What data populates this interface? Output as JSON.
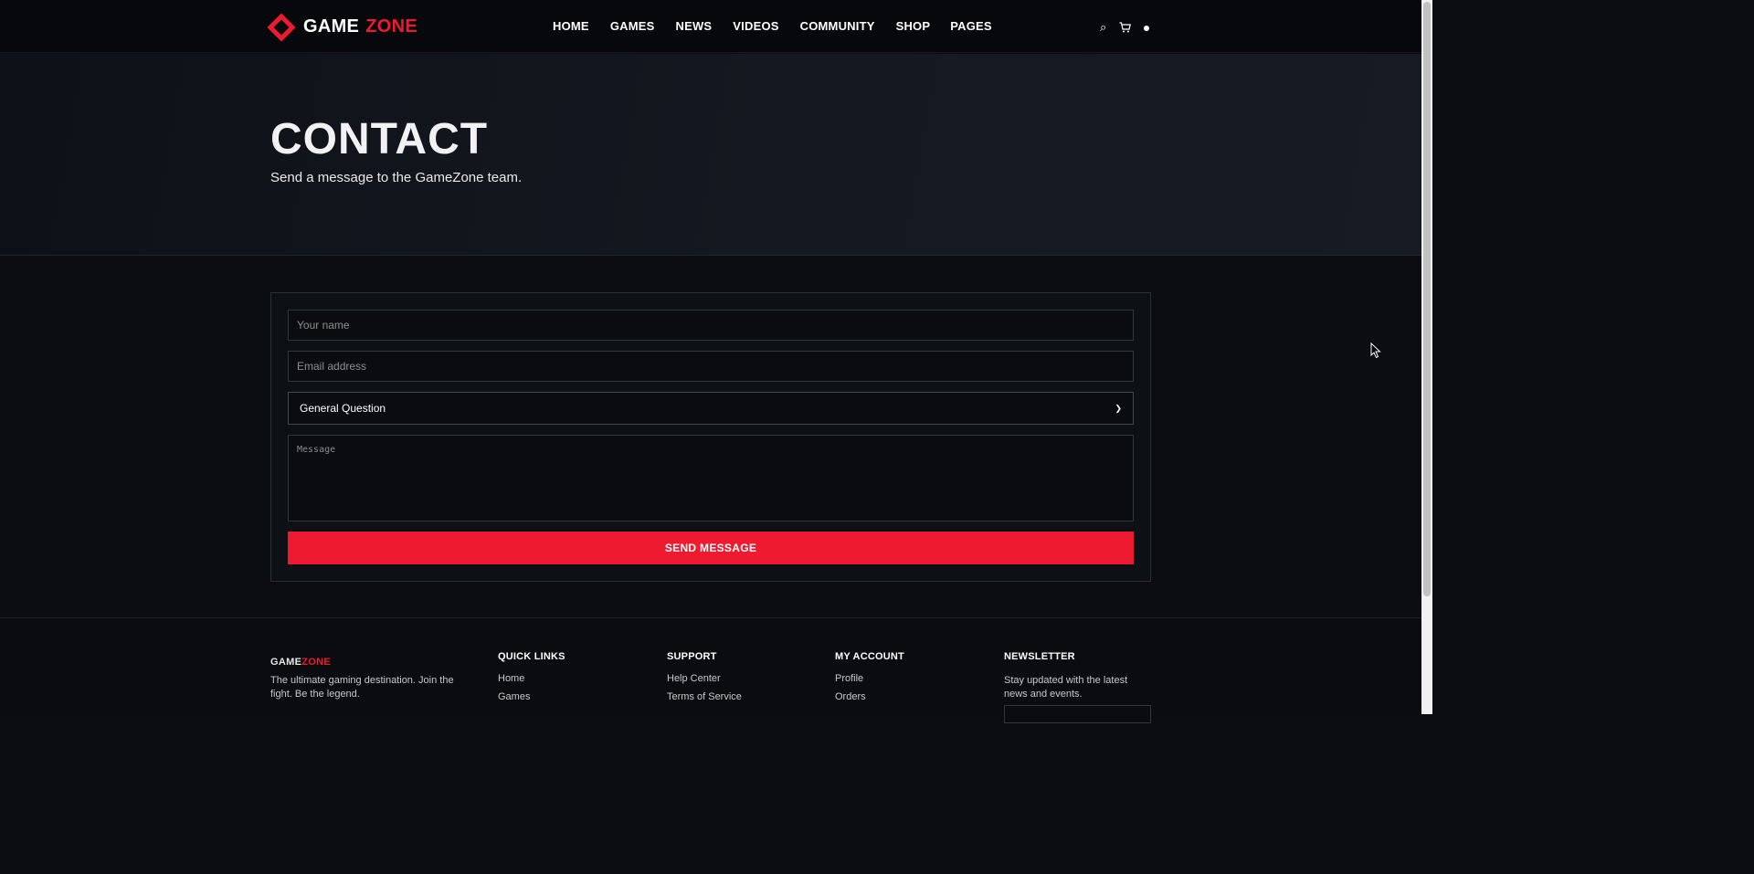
{
  "header": {
    "logo": {
      "part1": "GAME",
      "part2": "ZONE"
    },
    "nav": [
      "HOME",
      "GAMES",
      "NEWS",
      "VIDEOS",
      "COMMUNITY",
      "SHOP",
      "PAGES"
    ],
    "icons": [
      "search-icon",
      "cart-icon",
      "user-icon"
    ]
  },
  "hero": {
    "title": "CONTACT",
    "subtitle": "Send a message to the GameZone team."
  },
  "form": {
    "name_placeholder": "Your name",
    "email_placeholder": "Email address",
    "topic_selected": "General Question",
    "message_placeholder": "Message",
    "submit_label": "SEND MESSAGE"
  },
  "footer": {
    "brand": {
      "part1": "GAME",
      "part2": "ZONE"
    },
    "description": "The ultimate gaming destination. Join the fight. Be the legend.",
    "quick_links": {
      "title": "QUICK LINKS",
      "items": [
        "Home",
        "Games"
      ]
    },
    "support": {
      "title": "SUPPORT",
      "items": [
        "Help Center",
        "Terms of Service"
      ]
    },
    "account": {
      "title": "MY ACCOUNT",
      "items": [
        "Profile",
        "Orders"
      ]
    },
    "newsletter": {
      "title": "NEWSLETTER",
      "text": "Stay updated with the latest news and events."
    }
  },
  "colors": {
    "accent": "#ee1a2f",
    "background": "#0b0d12",
    "header": "#07080b"
  }
}
